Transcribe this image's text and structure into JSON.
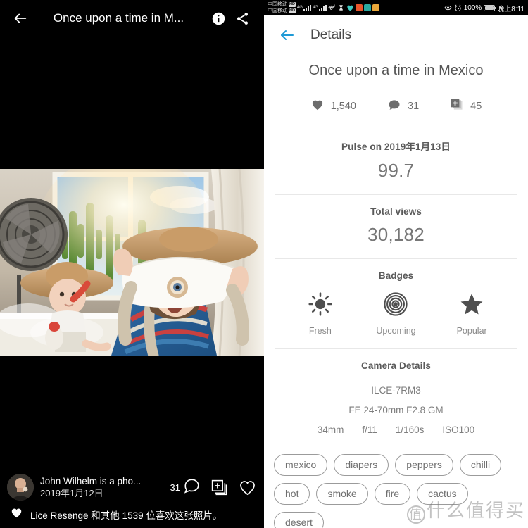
{
  "viewer": {
    "title": "Once upon a time in M...",
    "back_icon": "back-arrow-icon",
    "info_icon": "info-icon",
    "share_icon": "share-icon",
    "author": "John Wilhelm is a pho...",
    "date": "2019年1月12日",
    "comment_count": "31",
    "comment_icon": "comment-icon",
    "add_icon": "add-to-album-icon",
    "like_icon": "heart-outline-icon",
    "likes_heart_icon": "heart-filled-icon",
    "likes_text": "Lice Resenge 和其他 1539 位喜欢这张照片。",
    "photo_alt": "woman and baby with sombreros and chilli in sunlit room"
  },
  "statusbar": {
    "carrier_1": "中国移动",
    "carrier_2": "中国移动",
    "hd_label": "HD",
    "net_1": "4G",
    "net_2": "4G",
    "wifi_icon": "wifi-hotspot-icon",
    "hourglass_icon": "hourglass-icon",
    "heart_icon": "heart-app-icon",
    "app_icons": [
      "play-app-icon",
      "camera-app-icon",
      "gallery-app-icon"
    ],
    "eye_icon": "eye-protection-icon",
    "alarm_icon": "alarm-clock-icon",
    "battery_percent": "100%",
    "battery_icon": "battery-full-icon",
    "time": "晚上8:11"
  },
  "details": {
    "back_icon": "back-arrow-icon",
    "header_title": "Details",
    "photo_title": "Once upon a time in Mexico",
    "stats": [
      {
        "icon": "heart-filled-icon",
        "value": "1,540",
        "name": "likes"
      },
      {
        "icon": "comment-icon",
        "value": "31",
        "name": "comments"
      },
      {
        "icon": "add-to-album-icon",
        "value": "45",
        "name": "adds"
      }
    ],
    "pulse": {
      "title": "Pulse on 2019年1月13日",
      "value": "99.7"
    },
    "views": {
      "title": "Total views",
      "value": "30,182"
    },
    "badges": {
      "title": "Badges",
      "items": [
        {
          "icon": "sun-icon",
          "label": "Fresh"
        },
        {
          "icon": "concentric-circles-icon",
          "label": "Upcoming"
        },
        {
          "icon": "star-icon",
          "label": "Popular"
        }
      ]
    },
    "camera": {
      "title": "Camera Details",
      "body": "ILCE-7RM3",
      "lens": "FE 24-70mm F2.8 GM",
      "exif": [
        "34mm",
        "f/11",
        "1/160s",
        "ISO100"
      ]
    },
    "tags": [
      "mexico",
      "diapers",
      "peppers",
      "chilli",
      "hot",
      "smoke",
      "fire",
      "cactus",
      "desert"
    ]
  },
  "watermark": {
    "badge": "值",
    "text": "什么值得买"
  },
  "colors": {
    "accent_blue": "#1e9ad6",
    "text_primary": "#555555",
    "text_secondary": "#7d7d7d",
    "divider": "#e8e8e8",
    "background": "#ffffff",
    "viewer_background": "#000000"
  }
}
